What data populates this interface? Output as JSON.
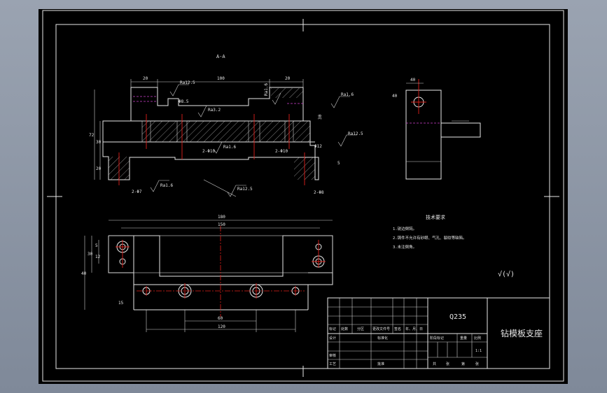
{
  "section_label": "A-A",
  "dimensions": {
    "top_left": "20",
    "top_mid": "100",
    "top_right": "20",
    "height_total": "72",
    "height_mid": "30",
    "height_low": "20",
    "side_30": "30",
    "hole_left": "Φ8.5",
    "hole_small": "Φ12",
    "bottom_hole": "2-Φ7",
    "mid_hole": "2-Φ10",
    "right_hole": "2-Φ8",
    "right_dim": "5",
    "side_top": "40",
    "side_left": "40",
    "plan_180": "180",
    "plan_150": "150",
    "plan_left_a": "5",
    "plan_left_b": "12",
    "plan_left_c": "30",
    "plan_left_d": "40",
    "plan_left_e": "15",
    "plan_bottom_60": "60",
    "plan_bottom_120": "120"
  },
  "roughness": {
    "r1": "Ra12.5",
    "r2": "Ra1.6",
    "r3": "Ra3.2",
    "r4": "Ra1.6",
    "r5": "Ra12.5",
    "r6": "Ra1.6",
    "r7": "Ra1.6",
    "r8": "Ra12.5",
    "r9": "Ra1.6",
    "r10": "Ra12.5"
  },
  "tech_requirements": {
    "title": "技术要求",
    "lines": [
      "1.锐边倒钝。",
      "2.铸件不允许有砂眼、气孔、裂纹等缺陷。",
      "3.未注倒角。"
    ]
  },
  "other_roughness": "√(√)",
  "title_block": {
    "material": "Q235",
    "drawing_name": "钻模板支座",
    "row_labels": [
      "标记",
      "处数",
      "分区",
      "更改文件号",
      "签名",
      "年、月、日"
    ],
    "design": "设计",
    "standard": "标准化",
    "review": "审核",
    "process": "工艺",
    "approve": "批准",
    "stage_header": [
      "阶段标记",
      "重量",
      "比例"
    ],
    "scale": "1:1",
    "sheets": [
      "共",
      "张",
      "第",
      "张"
    ]
  }
}
